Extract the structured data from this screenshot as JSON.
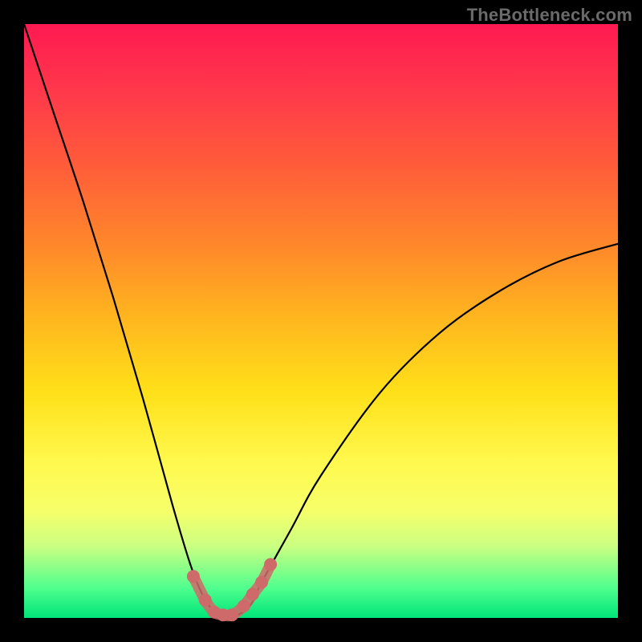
{
  "watermark": "TheBottleneck.com",
  "chart_data": {
    "type": "line",
    "title": "",
    "xlabel": "",
    "ylabel": "",
    "xlim": [
      0,
      100
    ],
    "ylim": [
      0,
      100
    ],
    "grid": false,
    "colors": {
      "gradient_top": "#ff1a52",
      "gradient_bottom": "#00e47a",
      "curve": "#000000",
      "markers": "#cf6a6a"
    },
    "series": [
      {
        "name": "bottleneck-curve",
        "x": [
          0,
          5,
          10,
          15,
          20,
          25,
          28,
          30,
          32,
          34,
          35,
          38,
          40,
          45,
          50,
          60,
          70,
          80,
          90,
          100
        ],
        "y": [
          100,
          85,
          70,
          54,
          37,
          19,
          9,
          4,
          1,
          0,
          0,
          2,
          6,
          15,
          24,
          38,
          48,
          55,
          60,
          63
        ]
      }
    ],
    "markers": {
      "name": "highlight-points",
      "x": [
        28.5,
        30.5,
        32,
        33.5,
        35,
        37,
        38.5,
        40,
        41.5
      ],
      "y": [
        7,
        3,
        1,
        0.5,
        0.5,
        2,
        4,
        6,
        9
      ]
    },
    "optimum_x": 34
  }
}
